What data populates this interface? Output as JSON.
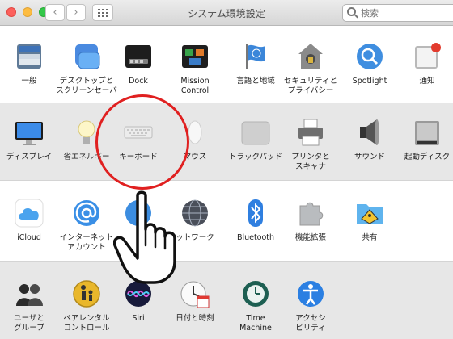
{
  "window": {
    "title": "システム環境設定"
  },
  "nav": {
    "back": "‹",
    "forward": "›"
  },
  "search": {
    "value": "検索"
  },
  "sections": [
    [
      {
        "name": "general",
        "label": "一般",
        "icon": "general-icon"
      },
      {
        "name": "desktop-screensaver",
        "label": "デスクトップと\nスクリーンセーバ",
        "icon": "desktop-icon"
      },
      {
        "name": "dock",
        "label": "Dock",
        "icon": "dock-icon"
      },
      {
        "name": "mission-control",
        "label": "Mission\nControl",
        "icon": "mission-control-icon"
      },
      {
        "name": "language-region",
        "label": "言語と地域",
        "icon": "flag-icon"
      },
      {
        "name": "security-privacy",
        "label": "セキュリティと\nプライバシー",
        "icon": "house-lock-icon"
      },
      {
        "name": "spotlight",
        "label": "Spotlight",
        "icon": "spotlight-icon"
      },
      {
        "name": "notifications",
        "label": "通知",
        "icon": "notifications-icon"
      }
    ],
    [
      {
        "name": "displays",
        "label": "ディスプレイ",
        "icon": "display-icon"
      },
      {
        "name": "energy-saver",
        "label": "省エネルギー",
        "icon": "bulb-icon"
      },
      {
        "name": "keyboard",
        "label": "キーボード",
        "icon": "keyboard-icon"
      },
      {
        "name": "mouse",
        "label": "マウス",
        "icon": "mouse-icon"
      },
      {
        "name": "trackpad",
        "label": "トラックパッド",
        "icon": "trackpad-icon"
      },
      {
        "name": "printers-scanners",
        "label": "プリンタと\nスキャナ",
        "icon": "printer-icon"
      },
      {
        "name": "sound",
        "label": "サウンド",
        "icon": "speaker-icon"
      },
      {
        "name": "startup-disk",
        "label": "起動ディスク",
        "icon": "disk-icon"
      }
    ],
    [
      {
        "name": "icloud",
        "label": "iCloud",
        "icon": "cloud-icon"
      },
      {
        "name": "internet-accounts",
        "label": "インターネット\nアカウント",
        "icon": "at-sign-icon"
      },
      {
        "name": "extensions-hidden",
        "label": "",
        "icon": "app-store-icon"
      },
      {
        "name": "network",
        "label": "ットワーク",
        "icon": "globe-icon"
      },
      {
        "name": "bluetooth",
        "label": "Bluetooth",
        "icon": "bluetooth-icon"
      },
      {
        "name": "extensions",
        "label": "機能拡張",
        "icon": "puzzle-icon"
      },
      {
        "name": "sharing",
        "label": "共有",
        "icon": "sharing-folder-icon"
      }
    ],
    [
      {
        "name": "users-groups",
        "label": "ユーザと\nグループ",
        "icon": "users-icon"
      },
      {
        "name": "parental-controls",
        "label": "ペアレンタル\nコントロール",
        "icon": "parental-icon"
      },
      {
        "name": "siri",
        "label": "Siri",
        "icon": "siri-icon"
      },
      {
        "name": "date-time",
        "label": "日付と時刻",
        "icon": "clock-calendar-icon"
      },
      {
        "name": "time-machine",
        "label": "Time\nMachine",
        "icon": "time-machine-icon"
      },
      {
        "name": "accessibility",
        "label": "アクセシ\nビリティ",
        "icon": "accessibility-icon"
      }
    ]
  ]
}
